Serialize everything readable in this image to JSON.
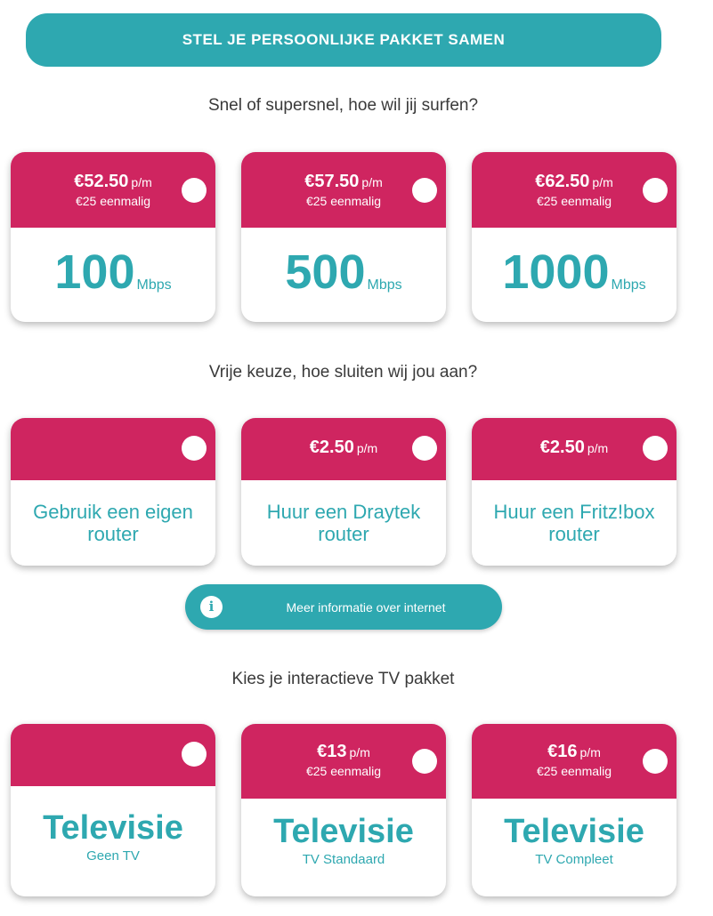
{
  "banner": {
    "title": "STEL JE PERSOONLIJKE PAKKET SAMEN"
  },
  "internet": {
    "heading": "Snel of supersnel, hoe wil jij surfen?",
    "options": [
      {
        "price": "€52.50",
        "per": "p/m",
        "once": "€25 eenmalig",
        "speed": "100",
        "unit": "Mbps"
      },
      {
        "price": "€57.50",
        "per": "p/m",
        "once": "€25 eenmalig",
        "speed": "500",
        "unit": "Mbps"
      },
      {
        "price": "€62.50",
        "per": "p/m",
        "once": "€25 eenmalig",
        "speed": "1000",
        "unit": "Mbps"
      }
    ]
  },
  "router": {
    "heading": "Vrije keuze, hoe sluiten wij jou aan?",
    "options": [
      {
        "price": "",
        "per": "",
        "label": "Gebruik een eigen router"
      },
      {
        "price": "€2.50",
        "per": "p/m",
        "label": "Huur een Draytek router"
      },
      {
        "price": "€2.50",
        "per": "p/m",
        "label": "Huur een Fritz!box router"
      }
    ]
  },
  "info": {
    "icon_text": "i",
    "label": "Meer informatie over internet"
  },
  "tv": {
    "heading": "Kies je interactieve TV pakket",
    "options": [
      {
        "price": "",
        "per": "",
        "once": "",
        "title": "Televisie",
        "subtitle": "Geen TV"
      },
      {
        "price": "€13",
        "per": "p/m",
        "once": "€25 eenmalig",
        "title": "Televisie",
        "subtitle": "TV Standaard"
      },
      {
        "price": "€16",
        "per": "p/m",
        "once": "€25 eenmalig",
        "title": "Televisie",
        "subtitle": "TV Compleet"
      }
    ]
  },
  "colors": {
    "primary": "#2ea8b0",
    "accent": "#cf2560"
  }
}
